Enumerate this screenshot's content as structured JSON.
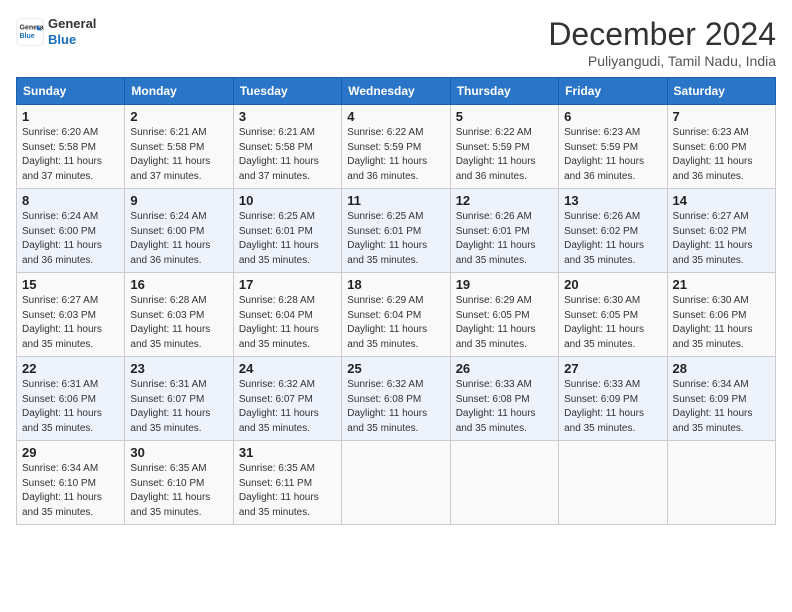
{
  "header": {
    "logo_line1": "General",
    "logo_line2": "Blue",
    "month": "December 2024",
    "location": "Puliyangudi, Tamil Nadu, India"
  },
  "weekdays": [
    "Sunday",
    "Monday",
    "Tuesday",
    "Wednesday",
    "Thursday",
    "Friday",
    "Saturday"
  ],
  "weeks": [
    [
      {
        "day": "1",
        "sunrise": "6:20 AM",
        "sunset": "5:58 PM",
        "daylight": "11 hours and 37 minutes."
      },
      {
        "day": "2",
        "sunrise": "6:21 AM",
        "sunset": "5:58 PM",
        "daylight": "11 hours and 37 minutes."
      },
      {
        "day": "3",
        "sunrise": "6:21 AM",
        "sunset": "5:58 PM",
        "daylight": "11 hours and 37 minutes."
      },
      {
        "day": "4",
        "sunrise": "6:22 AM",
        "sunset": "5:59 PM",
        "daylight": "11 hours and 36 minutes."
      },
      {
        "day": "5",
        "sunrise": "6:22 AM",
        "sunset": "5:59 PM",
        "daylight": "11 hours and 36 minutes."
      },
      {
        "day": "6",
        "sunrise": "6:23 AM",
        "sunset": "5:59 PM",
        "daylight": "11 hours and 36 minutes."
      },
      {
        "day": "7",
        "sunrise": "6:23 AM",
        "sunset": "6:00 PM",
        "daylight": "11 hours and 36 minutes."
      }
    ],
    [
      {
        "day": "8",
        "sunrise": "6:24 AM",
        "sunset": "6:00 PM",
        "daylight": "11 hours and 36 minutes."
      },
      {
        "day": "9",
        "sunrise": "6:24 AM",
        "sunset": "6:00 PM",
        "daylight": "11 hours and 36 minutes."
      },
      {
        "day": "10",
        "sunrise": "6:25 AM",
        "sunset": "6:01 PM",
        "daylight": "11 hours and 35 minutes."
      },
      {
        "day": "11",
        "sunrise": "6:25 AM",
        "sunset": "6:01 PM",
        "daylight": "11 hours and 35 minutes."
      },
      {
        "day": "12",
        "sunrise": "6:26 AM",
        "sunset": "6:01 PM",
        "daylight": "11 hours and 35 minutes."
      },
      {
        "day": "13",
        "sunrise": "6:26 AM",
        "sunset": "6:02 PM",
        "daylight": "11 hours and 35 minutes."
      },
      {
        "day": "14",
        "sunrise": "6:27 AM",
        "sunset": "6:02 PM",
        "daylight": "11 hours and 35 minutes."
      }
    ],
    [
      {
        "day": "15",
        "sunrise": "6:27 AM",
        "sunset": "6:03 PM",
        "daylight": "11 hours and 35 minutes."
      },
      {
        "day": "16",
        "sunrise": "6:28 AM",
        "sunset": "6:03 PM",
        "daylight": "11 hours and 35 minutes."
      },
      {
        "day": "17",
        "sunrise": "6:28 AM",
        "sunset": "6:04 PM",
        "daylight": "11 hours and 35 minutes."
      },
      {
        "day": "18",
        "sunrise": "6:29 AM",
        "sunset": "6:04 PM",
        "daylight": "11 hours and 35 minutes."
      },
      {
        "day": "19",
        "sunrise": "6:29 AM",
        "sunset": "6:05 PM",
        "daylight": "11 hours and 35 minutes."
      },
      {
        "day": "20",
        "sunrise": "6:30 AM",
        "sunset": "6:05 PM",
        "daylight": "11 hours and 35 minutes."
      },
      {
        "day": "21",
        "sunrise": "6:30 AM",
        "sunset": "6:06 PM",
        "daylight": "11 hours and 35 minutes."
      }
    ],
    [
      {
        "day": "22",
        "sunrise": "6:31 AM",
        "sunset": "6:06 PM",
        "daylight": "11 hours and 35 minutes."
      },
      {
        "day": "23",
        "sunrise": "6:31 AM",
        "sunset": "6:07 PM",
        "daylight": "11 hours and 35 minutes."
      },
      {
        "day": "24",
        "sunrise": "6:32 AM",
        "sunset": "6:07 PM",
        "daylight": "11 hours and 35 minutes."
      },
      {
        "day": "25",
        "sunrise": "6:32 AM",
        "sunset": "6:08 PM",
        "daylight": "11 hours and 35 minutes."
      },
      {
        "day": "26",
        "sunrise": "6:33 AM",
        "sunset": "6:08 PM",
        "daylight": "11 hours and 35 minutes."
      },
      {
        "day": "27",
        "sunrise": "6:33 AM",
        "sunset": "6:09 PM",
        "daylight": "11 hours and 35 minutes."
      },
      {
        "day": "28",
        "sunrise": "6:34 AM",
        "sunset": "6:09 PM",
        "daylight": "11 hours and 35 minutes."
      }
    ],
    [
      {
        "day": "29",
        "sunrise": "6:34 AM",
        "sunset": "6:10 PM",
        "daylight": "11 hours and 35 minutes."
      },
      {
        "day": "30",
        "sunrise": "6:35 AM",
        "sunset": "6:10 PM",
        "daylight": "11 hours and 35 minutes."
      },
      {
        "day": "31",
        "sunrise": "6:35 AM",
        "sunset": "6:11 PM",
        "daylight": "11 hours and 35 minutes."
      },
      null,
      null,
      null,
      null
    ]
  ]
}
